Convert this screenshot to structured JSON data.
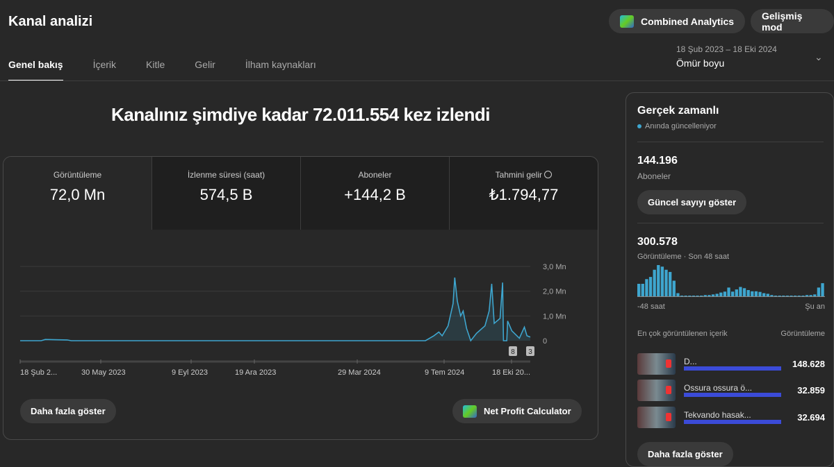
{
  "header": {
    "title": "Kanal analizi",
    "combined": "Combined Analytics",
    "advanced": "Gelişmiş mod",
    "date_range": "18 Şub 2023 – 18 Eki 2024",
    "period": "Ömür boyu"
  },
  "tabs": [
    {
      "label": "Genel bakış",
      "active": true
    },
    {
      "label": "İçerik"
    },
    {
      "label": "Kitle"
    },
    {
      "label": "Gelir"
    },
    {
      "label": "İlham kaynakları"
    }
  ],
  "headline": "Kanalınız şimdiye kadar 72.011.554 kez izlendi",
  "metrics": [
    {
      "label": "Görüntüleme",
      "value": "72,0 Mn"
    },
    {
      "label": "İzlenme süresi (saat)",
      "value": "574,5 B"
    },
    {
      "label": "Aboneler",
      "value": "+144,2 B"
    },
    {
      "label": "Tahmini gelir",
      "value": "₺1.794,77"
    }
  ],
  "chart_data": {
    "type": "area",
    "color": "#3ea6cf",
    "ylim": [
      0,
      3000000
    ],
    "yticks": [
      "3,0 Mn",
      "2,0 Mn",
      "1,0 Mn",
      "0"
    ],
    "xticks": [
      "18 Şub 2...",
      "30 May 2023",
      "9 Eyl 2023",
      "19 Ara 2023",
      "29 Mar 2024",
      "9 Tem 2024",
      "18 Eki 20..."
    ],
    "points": [
      [
        "2023-02-18",
        0
      ],
      [
        "2023-03-15",
        0
      ],
      [
        "2023-03-20",
        50000
      ],
      [
        "2023-04-01",
        40000
      ],
      [
        "2023-04-15",
        30000
      ],
      [
        "2023-04-20",
        0
      ],
      [
        "2024-06-15",
        0
      ],
      [
        "2024-06-25",
        200000
      ],
      [
        "2024-07-01",
        350000
      ],
      [
        "2024-07-05",
        200000
      ],
      [
        "2024-07-12",
        600000
      ],
      [
        "2024-07-18",
        1500000
      ],
      [
        "2024-07-20",
        2550000
      ],
      [
        "2024-07-23",
        1600000
      ],
      [
        "2024-07-27",
        1000000
      ],
      [
        "2024-07-30",
        1200000
      ],
      [
        "2024-08-03",
        500000
      ],
      [
        "2024-08-08",
        0
      ],
      [
        "2024-08-15",
        300000
      ],
      [
        "2024-08-25",
        600000
      ],
      [
        "2024-08-30",
        1200000
      ],
      [
        "2024-09-02",
        2300000
      ],
      [
        "2024-09-05",
        700000
      ],
      [
        "2024-09-12",
        900000
      ],
      [
        "2024-09-15",
        2350000
      ],
      [
        "2024-09-16",
        0
      ],
      [
        "2024-09-20",
        0
      ],
      [
        "2024-09-21",
        800000
      ],
      [
        "2024-09-26",
        400000
      ],
      [
        "2024-10-05",
        100000
      ],
      [
        "2024-10-11",
        550000
      ],
      [
        "2024-10-14",
        200000
      ],
      [
        "2024-10-18",
        150000
      ]
    ],
    "markers": [
      "8",
      "3"
    ]
  },
  "more_button": "Daha fazla göster",
  "net_profit": "Net Profit Calculator",
  "realtime": {
    "title": "Gerçek zamanlı",
    "subtitle": "Anında güncelleniyor",
    "subs_value": "144.196",
    "subs_label": "Aboneler",
    "subs_button": "Güncel sayıyı göster",
    "views_value": "300.578",
    "views_label": "Görüntüleme · Son 48 saat",
    "bars": [
      0.4,
      0.4,
      0.55,
      0.62,
      0.85,
      1,
      0.95,
      0.85,
      0.78,
      0.5,
      0.1,
      0.02,
      0.02,
      0.02,
      0.02,
      0.02,
      0.02,
      0.04,
      0.04,
      0.06,
      0.08,
      0.12,
      0.15,
      0.28,
      0.15,
      0.22,
      0.3,
      0.26,
      0.2,
      0.16,
      0.16,
      0.14,
      0.1,
      0.08,
      0.04,
      0.02,
      0.02,
      0.02,
      0.02,
      0.02,
      0.02,
      0.02,
      0.02,
      0.04,
      0.04,
      0.06,
      0.28,
      0.42
    ],
    "axis_start": "-48 saat",
    "axis_end": "Şu an",
    "top_header": "En çok görüntülenen içerik",
    "top_col": "Görüntüleme",
    "top": [
      {
        "title": "D...",
        "views": "148.628"
      },
      {
        "title": "Ossura ossura ö...",
        "views": "32.859"
      },
      {
        "title": "Tekvando hasak...",
        "views": "32.694"
      }
    ],
    "more_button": "Daha fazla göster",
    "accent": "#3ea6cf"
  }
}
